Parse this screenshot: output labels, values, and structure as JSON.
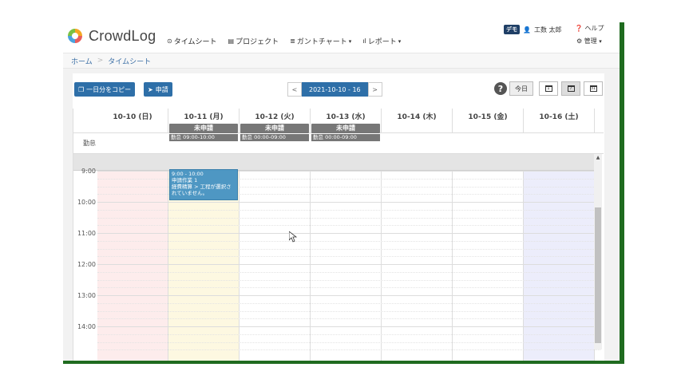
{
  "app": {
    "logo_text": "CrowdLog",
    "nav": [
      {
        "icon": "clock-icon",
        "glyph": "⊙",
        "label": "タイムシート",
        "dropdown": false
      },
      {
        "icon": "project-icon",
        "glyph": "▤",
        "label": "プロジェクト",
        "dropdown": false
      },
      {
        "icon": "gantt-icon",
        "glyph": "≣",
        "label": "ガントチャート",
        "dropdown": true
      },
      {
        "icon": "report-icon",
        "glyph": "ıl",
        "label": "レポート",
        "dropdown": true
      }
    ],
    "user": {
      "badge": "デモ",
      "name": "工数 太郎"
    },
    "help_label": "ヘルプ",
    "admin_label": "管理"
  },
  "breadcrumb": {
    "home": "ホーム",
    "current": "タイムシート"
  },
  "toolbar": {
    "copy_day_label": "一日分をコピー",
    "apply_label": "申請",
    "prev": "<",
    "date_range": "2021-10-10 - 16",
    "next": ">",
    "help_glyph": "?",
    "today_label": "今日",
    "view_day": "1",
    "view_week": "7",
    "view_month": "31"
  },
  "calendar": {
    "attendance_label": "勤怠",
    "days": [
      {
        "label": "10-10 (日)",
        "status": "",
        "attendance": "",
        "bg": "#fdecec"
      },
      {
        "label": "10-11 (月)",
        "status": "未申請",
        "attendance": "勤怠 09:00-10:00",
        "bg": "#fdf8e1"
      },
      {
        "label": "10-12 (火)",
        "status": "未申請",
        "attendance": "勤怠 00:00-09:00",
        "bg": "#ffffff"
      },
      {
        "label": "10-13 (水)",
        "status": "未申請",
        "attendance": "勤怠 00:00-09:00",
        "bg": "#ffffff"
      },
      {
        "label": "10-14 (木)",
        "status": "",
        "attendance": "",
        "bg": "#ffffff"
      },
      {
        "label": "10-15 (金)",
        "status": "",
        "attendance": "",
        "bg": "#ffffff"
      },
      {
        "label": "10-16 (土)",
        "status": "",
        "attendance": "",
        "bg": "#ecedfb"
      }
    ],
    "times": [
      "9:00",
      "10:00",
      "11:00",
      "12:00",
      "13:00",
      "14:00"
    ],
    "event": {
      "day_index": 1,
      "time": "9:00 - 10:00",
      "title": "申請作業 1",
      "detail": "経費精算 > 工程が選択されていません。"
    }
  },
  "colors": {
    "accent": "#2e6fa8",
    "status_gray": "#777777",
    "event": "#4e97c3",
    "frame": "#1f6b1f"
  }
}
